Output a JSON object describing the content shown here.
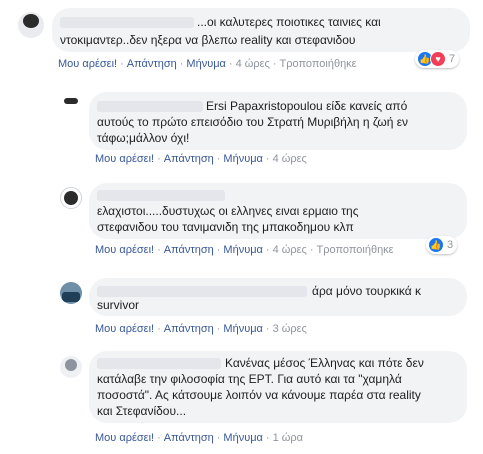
{
  "comments": [
    {
      "text_lines": [
        "...οι καλυτερες ποιοτικες ταινιες και",
        "ντοκιμαντερ..δεν ηξερα να βλεπω reality και στεφανιδου"
      ],
      "actions": {
        "like": "Μου αρέσει!",
        "reply": "Απάντηση",
        "message": "Μήνυμα",
        "time": "4 ώρες",
        "edited": "Τροποποιήθηκε"
      },
      "reactions": {
        "count": "7",
        "types": [
          "like-icon",
          "love-icon"
        ]
      }
    },
    {
      "text_lines": [
        "Ersi Papaxristopoulou είδε κανείς από",
        "αυτούς το πρώτο επεισόδιο του Στρατή Μυριβήλη η ζωή εν",
        "τάφω;μάλλον όχι!"
      ],
      "actions": {
        "like": "Μου αρέσει!",
        "reply": "Απάντηση",
        "message": "Μήνυμα",
        "time": "4 ώρες"
      }
    },
    {
      "text_lines": [
        "ελαχιστοι.....δυστυχως οι ελληνες ειναι ερμαιο της",
        "στεφανιδου του τανιμανιδη της μπακοδημου κλπ"
      ],
      "actions": {
        "like": "Μου αρέσει!",
        "reply": "Απάντηση",
        "message": "Μήνυμα",
        "time": "4 ώρες",
        "edited": "Τροποποιήθηκε"
      },
      "reactions": {
        "count": "3",
        "types": [
          "like-icon"
        ]
      }
    },
    {
      "text_lines": [
        "άρα μόνο τουρκικά κ",
        "survivor"
      ],
      "actions": {
        "like": "Μου αρέσει!",
        "reply": "Απάντηση",
        "message": "Μήνυμα",
        "time": "3 ώρες"
      }
    },
    {
      "text_lines": [
        "Κανένας μέσος Έλληνας και πότε δεν",
        "κατάλαβε την φιλοσοφία της ΕΡΤ. Για αυτό και τα \"χαμηλά",
        "ποσοστά\". Ας κάτσουμε λοιπόν να κάνουμε παρέα στα reality",
        "και Στεφανίδου..."
      ],
      "actions": {
        "like": "Μου αρέσει!",
        "reply": "Απάντηση",
        "message": "Μήνυμα",
        "time": "1 ώρα"
      }
    }
  ],
  "colors": {
    "link": "#385898",
    "meta": "#90949c",
    "bubble": "#f2f3f5",
    "like": "#1877f2",
    "love": "#f33e58"
  }
}
